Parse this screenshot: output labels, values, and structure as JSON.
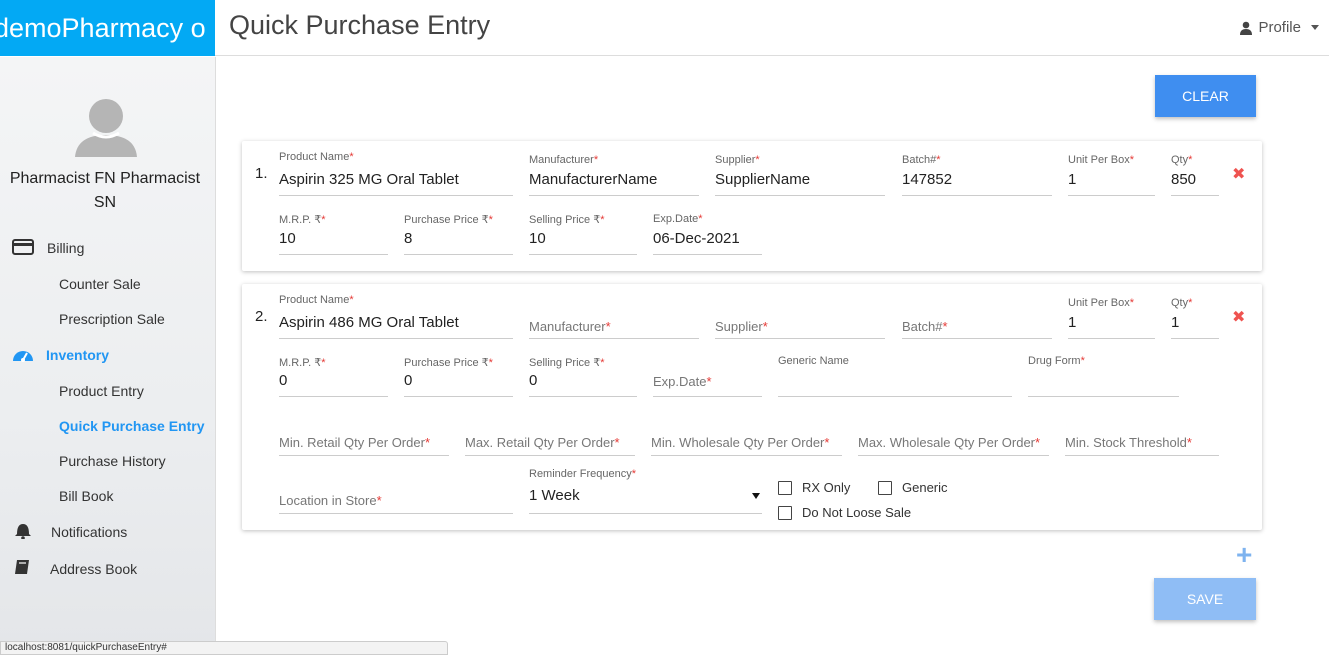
{
  "app": {
    "brand": "demoPharmacy o",
    "page_title": "Quick Purchase Entry",
    "profile_label": "Profile"
  },
  "sidebar": {
    "user_name": "Pharmacist FN Pharmacist SN",
    "billing": "Billing",
    "counter_sale": "Counter Sale",
    "prescription_sale": "Prescription Sale",
    "inventory": "Inventory",
    "product_entry": "Product Entry",
    "quick_purchase_entry": "Quick Purchase Entry",
    "purchase_history": "Purchase History",
    "bill_book": "Bill Book",
    "notifications": "Notifications",
    "address_book": "Address Book"
  },
  "actions": {
    "clear": "CLEAR",
    "save": "SAVE"
  },
  "colors": {
    "brand": "#03a9f4",
    "primary": "#3f8ef0",
    "active_nav": "#2196f3",
    "required": "#e53935"
  },
  "entries": [
    {
      "index": "1.",
      "product_name_label": "Product Name",
      "product_name": "Aspirin 325 MG Oral Tablet",
      "manufacturer_label": "Manufacturer",
      "manufacturer": "ManufacturerName",
      "supplier_label": "Supplier",
      "supplier": "SupplierName",
      "batch_label": "Batch#",
      "batch": "147852",
      "unit_per_box_label": "Unit Per Box",
      "unit_per_box": "1",
      "qty_label": "Qty",
      "qty": "850",
      "mrp_label": "M.R.P. ₹",
      "mrp": "10",
      "purchase_price_label": "Purchase Price ₹",
      "purchase_price": "8",
      "selling_price_label": "Selling Price ₹",
      "selling_price": "10",
      "exp_date_label": "Exp.Date",
      "exp_date": "06-Dec-2021",
      "remove_icon": "close-icon"
    },
    {
      "index": "2.",
      "product_name_label": "Product Name",
      "product_name": "Aspirin 486 MG Oral Tablet",
      "manufacturer_placeholder": "Manufacturer",
      "supplier_placeholder": "Supplier",
      "batch_placeholder": "Batch#",
      "unit_per_box_label": "Unit Per Box",
      "unit_per_box": "1",
      "qty_label": "Qty",
      "qty": "1",
      "mrp_label": "M.R.P. ₹",
      "mrp": "0",
      "purchase_price_label": "Purchase Price ₹",
      "purchase_price": "0",
      "selling_price_label": "Selling Price ₹",
      "selling_price": "0",
      "exp_date_placeholder": "Exp.Date",
      "generic_name_label": "Generic Name",
      "drug_form_label": "Drug Form",
      "min_retail_placeholder": "Min. Retail Qty Per Order",
      "max_retail_placeholder": "Max. Retail Qty Per Order",
      "min_wholesale_placeholder": "Min. Wholesale Qty Per Order",
      "max_wholesale_placeholder": "Max. Wholesale Qty Per Order",
      "min_stock_placeholder": "Min. Stock Threshold",
      "location_placeholder": "Location in Store",
      "reminder_label": "Reminder Frequency",
      "reminder_value": "1 Week",
      "rx_only": "RX Only",
      "generic": "Generic",
      "do_not_loose_sale": "Do Not Loose Sale",
      "remove_icon": "close-icon"
    }
  ],
  "statusbar": "localhost:8081/quickPurchaseEntry#"
}
